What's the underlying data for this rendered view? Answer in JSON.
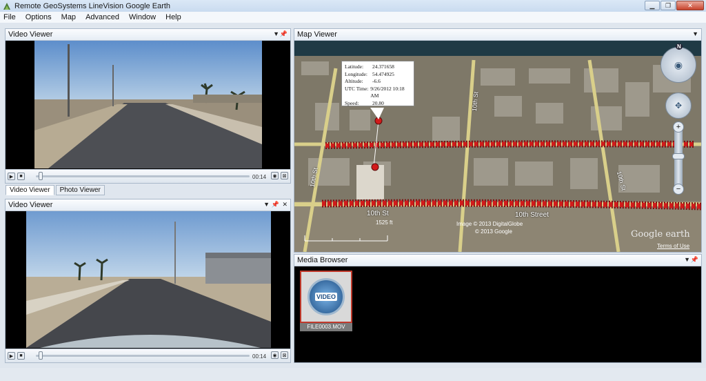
{
  "window": {
    "title": "Remote GeoSystems LineVision Google Earth"
  },
  "menu": [
    "File",
    "Options",
    "Map",
    "Advanced",
    "Window",
    "Help"
  ],
  "video_top": {
    "title": "Video Viewer",
    "time": "00:14",
    "progress": 0.02
  },
  "tabs": [
    {
      "label": "Video Viewer",
      "active": true
    },
    {
      "label": "Photo Viewer",
      "active": false
    }
  ],
  "video_bottom": {
    "title": "Video Viewer",
    "time": "00:14",
    "progress": 0.02
  },
  "map": {
    "title": "Map Viewer",
    "popup": [
      {
        "key": "Latitude:",
        "value": "24.371658"
      },
      {
        "key": "Longitude:",
        "value": "54.474925"
      },
      {
        "key": "Altitude:",
        "value": "-6.6"
      },
      {
        "key": "UTC Time:",
        "value": "9/26/2012 10:18 AM"
      },
      {
        "key": "Speed:",
        "value": "20.80"
      }
    ],
    "street_labels": [
      "10th St",
      "10th Street",
      "10th St",
      "10th St",
      "10th St"
    ],
    "scale_label": "1525 ft",
    "copyright1": "Image © 2013 DigitalGlobe",
    "copyright2": "© 2013 Google",
    "brand": "Google earth",
    "terms": "Terms of Use",
    "compass_n": "N"
  },
  "media": {
    "title": "Media Browser",
    "items": [
      {
        "badge": "VIDEO",
        "filename": "FILE0003.MOV"
      }
    ]
  }
}
